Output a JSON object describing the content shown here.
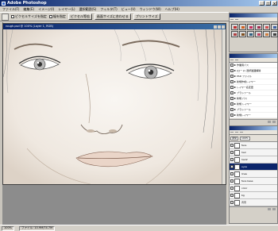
{
  "app": {
    "title": "Adobe Photoshop"
  },
  "menu": [
    "ファイル(F)",
    "編集(E)",
    "イメージ(I)",
    "レイヤー(L)",
    "選択範囲(S)",
    "フィルタ(T)",
    "ビュー(V)",
    "ウィンドウ(W)",
    "ヘルプ(H)"
  ],
  "options": {
    "btn1": "ピクセルサイズを指定",
    "btn2": "幅を指定",
    "btn3": "ピクセル等倍",
    "btn4": "画面サイズに合わせる",
    "btn5": "プリントサイズ"
  },
  "document": {
    "title": "rough.psd @ 100% (Layer 1, RGB)"
  },
  "status": {
    "zoom": "100%",
    "doc": "ファイル: 10.9M/74.7M"
  },
  "history": {
    "items": [
      "作業用パス",
      "(ロード) 選択範囲解除",
      "PSD ファイル",
      "新規作成レイヤー",
      "レイヤー名変更",
      "ブラシツール",
      "新規 パス",
      "新規 レイヤー",
      "ブラシツール",
      "新規レイヤー",
      "ブラシツール",
      "消しゴムツール",
      "ブラシツール",
      "選択範囲 解除"
    ]
  },
  "layers": {
    "mode": "通常",
    "opacity": "100%",
    "rows": [
      {
        "name": "face"
      },
      {
        "name": "hair"
      },
      {
        "name": "hair2"
      },
      {
        "name": "eyes",
        "selected": true
      },
      {
        "name": "lines"
      },
      {
        "name": "face base"
      },
      {
        "name": "color"
      },
      {
        "name": "bg"
      },
      {
        "name": "背景"
      }
    ]
  }
}
